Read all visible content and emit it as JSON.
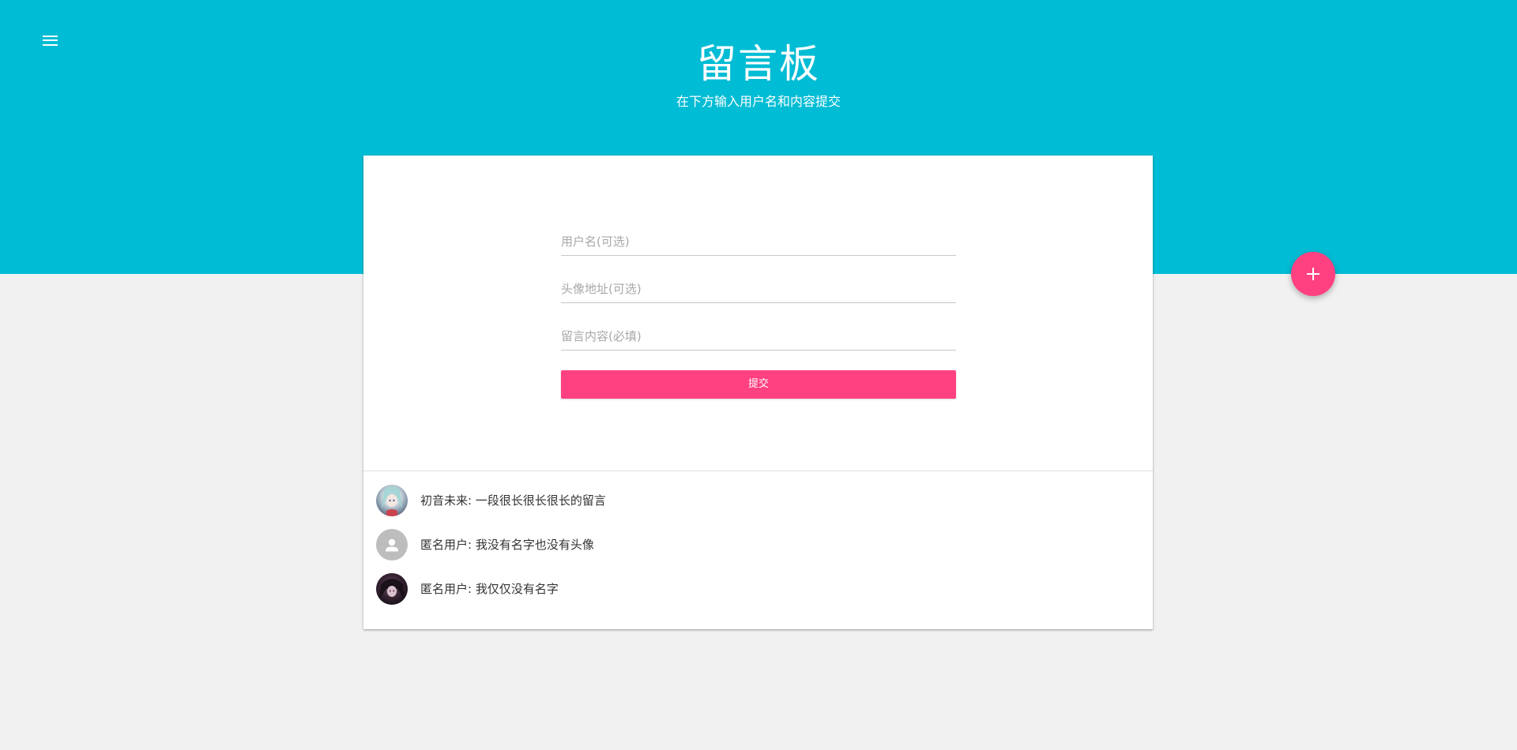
{
  "header": {
    "title": "留言板",
    "subtitle": "在下方输入用户名和内容提交",
    "menu_icon": "menu-icon",
    "background_color": "#00bcd4"
  },
  "fab": {
    "label": "+",
    "icon": "plus-icon",
    "color": "#ff4081"
  },
  "form": {
    "username_placeholder": "用户名(可选)",
    "username_value": "",
    "avatar_placeholder": "头像地址(可选)",
    "avatar_value": "",
    "content_placeholder": "留言内容(必填)",
    "content_value": "",
    "submit_label": "提交",
    "submit_color": "#ff4081"
  },
  "messages": [
    {
      "text": "初音未来: 一段很长很长很长的留言",
      "avatar": "miku-avatar-image"
    },
    {
      "text": "匿名用户: 我没有名字也没有头像",
      "avatar": "default-user-icon"
    },
    {
      "text": "匿名用户: 我仅仅没有名字",
      "avatar": "dark-avatar-image"
    }
  ]
}
